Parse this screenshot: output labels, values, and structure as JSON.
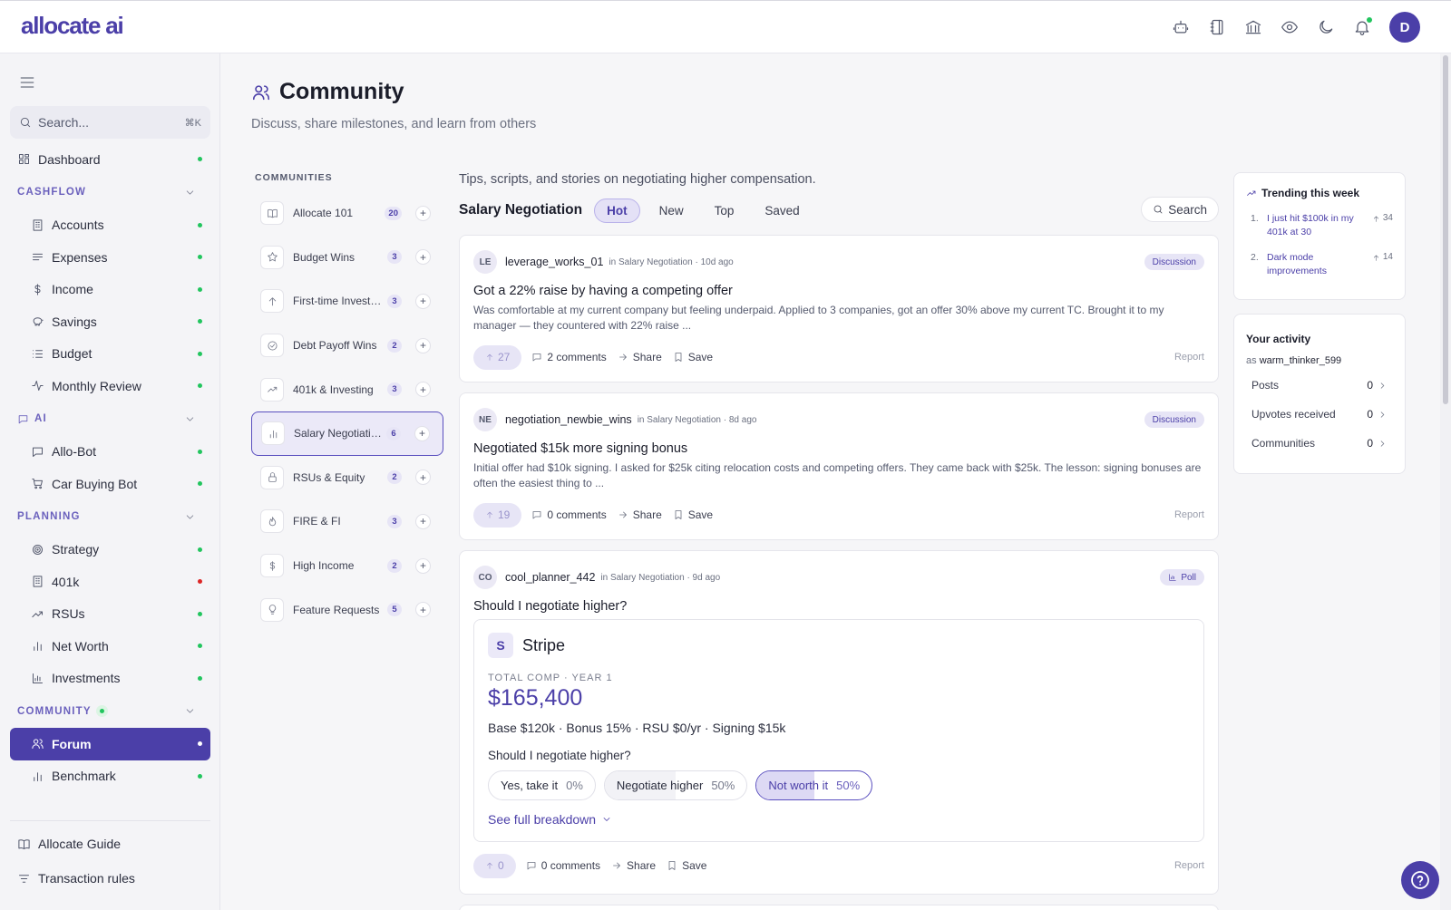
{
  "app": {
    "logo": "allocate ai",
    "user_initial": "D"
  },
  "sidebar": {
    "search_placeholder": "Search...",
    "search_shortcut": "⌘K",
    "dashboard": "Dashboard",
    "sections": {
      "cashflow": {
        "label": "CASHFLOW",
        "items": [
          "Accounts",
          "Expenses",
          "Income",
          "Savings",
          "Budget",
          "Monthly Review"
        ]
      },
      "ai": {
        "label": "AI",
        "items": [
          "Allo-Bot",
          "Car Buying Bot"
        ]
      },
      "planning": {
        "label": "PLANNING",
        "items": [
          "Strategy",
          "401k",
          "RSUs",
          "Net Worth",
          "Investments"
        ]
      },
      "community": {
        "label": "COMMUNITY",
        "items": [
          "Forum",
          "Benchmark"
        ]
      }
    },
    "bottom": [
      "Allocate Guide",
      "Transaction rules"
    ]
  },
  "page": {
    "title": "Community",
    "subtitle": "Discuss, share milestones, and learn from others"
  },
  "communities": {
    "header": "COMMUNITIES",
    "items": [
      {
        "name": "Allocate 101",
        "count": "20"
      },
      {
        "name": "Budget Wins",
        "count": "3"
      },
      {
        "name": "First-time Investors",
        "count": "3"
      },
      {
        "name": "Debt Payoff Wins",
        "count": "2"
      },
      {
        "name": "401k & Investing",
        "count": "3"
      },
      {
        "name": "Salary Negotiation",
        "count": "6"
      },
      {
        "name": "RSUs & Equity",
        "count": "2"
      },
      {
        "name": "FIRE & FI",
        "count": "3"
      },
      {
        "name": "High Income",
        "count": "2"
      },
      {
        "name": "Feature Requests",
        "count": "5"
      }
    ]
  },
  "feed": {
    "description": "Tips, scripts, and stories on negotiating higher compensation.",
    "community_name": "Salary Negotiation",
    "tabs": [
      "Hot",
      "New",
      "Top",
      "Saved"
    ],
    "search_label": "Search",
    "posts": [
      {
        "initials": "LE",
        "user": "leverage_works_01",
        "meta": "in Salary Negotiation · 10d ago",
        "tag": "Discussion",
        "title": "Got a 22% raise by having a competing offer",
        "body": "Was comfortable at my current company but feeling underpaid. Applied to 3 companies, got an offer 30% above my current TC. Brought it to my manager — they countered with 22% raise ...",
        "votes": "27",
        "comments": "2 comments",
        "share": "Share",
        "save": "Save",
        "report": "Report"
      },
      {
        "initials": "NE",
        "user": "negotiation_newbie_wins",
        "meta": "in Salary Negotiation · 8d ago",
        "tag": "Discussion",
        "title": "Negotiated $15k more signing bonus",
        "body": "Initial offer had $10k signing. I asked for $25k citing relocation costs and competing offers. They came back with $25k. The lesson: signing bonuses are often the easiest thing to ...",
        "votes": "19",
        "comments": "0 comments",
        "share": "Share",
        "save": "Save",
        "report": "Report"
      },
      {
        "initials": "CO",
        "user": "cool_planner_442",
        "meta": "in Salary Negotiation · 9d ago",
        "tag": "Poll",
        "title": "Should I negotiate higher?",
        "votes": "0",
        "comments": "0 comments",
        "share": "Share",
        "save": "Save",
        "report": "Report",
        "offer": {
          "company_initial": "S",
          "company": "Stripe",
          "label": "TOTAL COMP · YEAR 1",
          "total": "$165,400",
          "detail": "Base $120k · Bonus 15% · RSU $0/yr · Signing $15k",
          "question": "Should I negotiate higher?",
          "options": [
            {
              "label": "Yes, take it",
              "pct": "0%",
              "share": 0.0
            },
            {
              "label": "Negotiate higher",
              "pct": "50%",
              "share": 0.5
            },
            {
              "label": "Not worth it",
              "pct": "50%",
              "share": 0.5
            }
          ],
          "breakdown": "See full breakdown"
        }
      }
    ]
  },
  "trending": {
    "title": "Trending this week",
    "items": [
      {
        "num": "1.",
        "title": "I just hit $100k in my 401k at 30",
        "votes": "34"
      },
      {
        "num": "2.",
        "title": "Dark mode improvements",
        "votes": "14"
      }
    ]
  },
  "activity": {
    "title": "Your activity",
    "as_prefix": "as",
    "username": "warm_thinker_599",
    "rows": [
      {
        "label": "Posts",
        "value": "0"
      },
      {
        "label": "Upvotes received",
        "value": "0"
      },
      {
        "label": "Communities",
        "value": "0"
      }
    ]
  },
  "colors": {
    "accent": "#4b3fa8",
    "status_green": "#22c55e",
    "status_red": "#dc2626"
  }
}
